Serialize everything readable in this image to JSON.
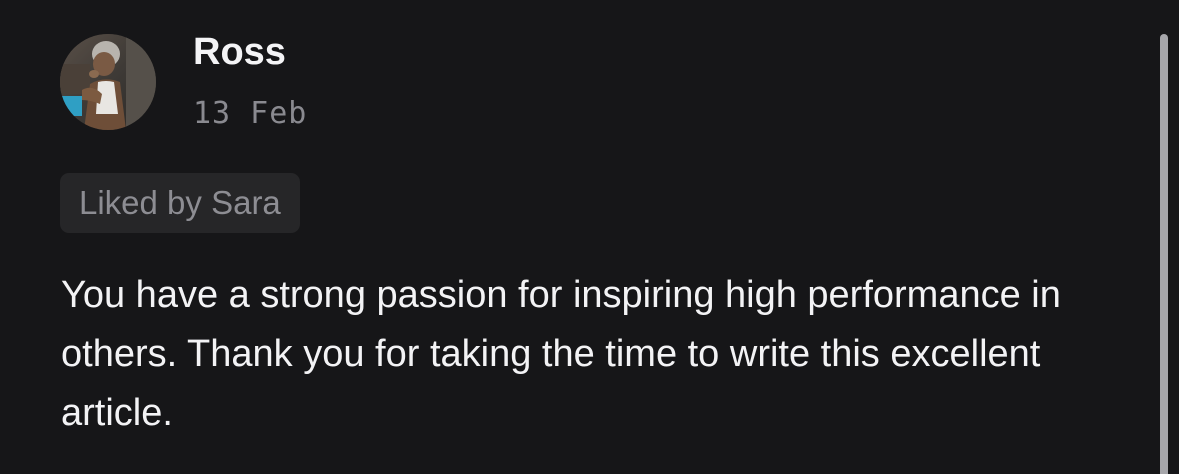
{
  "comment": {
    "author": {
      "name": "Ross",
      "avatar_icon": "user-photo-avatar"
    },
    "date": "13 Feb",
    "liked_by": "Liked by Sara",
    "body": "You have a strong passion for inspiring high performance in others. Thank you for taking the time to write this excellent article."
  },
  "colors": {
    "background": "#161618",
    "text_primary": "#f3f3f5",
    "text_secondary": "#8a8a90",
    "badge_background": "#262628",
    "scrollbar": "#a6a6aa"
  }
}
